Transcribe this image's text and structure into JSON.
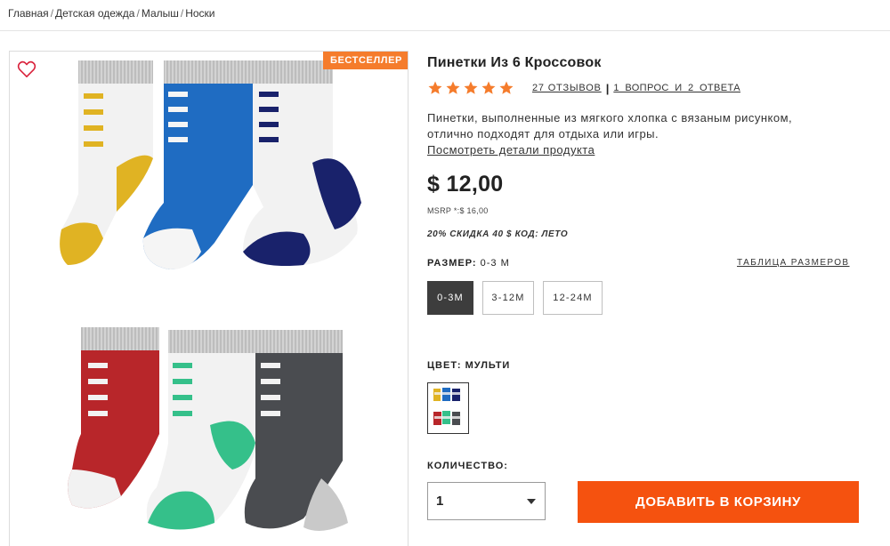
{
  "breadcrumb": {
    "items": [
      "Главная",
      "Детская одежда",
      "Малыш",
      "Носки"
    ],
    "separator": "/"
  },
  "product": {
    "badge": "БЕСТСЕЛЛЕР",
    "title": "Пинетки Из 6 Кроссовок",
    "rating": 5,
    "rating_max": 5,
    "reviews_label": "27 ОТЗЫВОВ",
    "qa_label": "1 ВОПРОС  И  2 ОТВЕТА",
    "description_line1": "Пинетки, выполненные из мягкого хлопка с вязаным рисунком,",
    "description_line2": "отлично подходят для отдыха или игры.",
    "details_link": "Посмотреть детали продукта",
    "price": "$ 12,00",
    "msrp": "MSRP *:$ 16,00",
    "promo": "20% СКИДКА 40 $ КОД: ЛЕТО"
  },
  "size": {
    "label": "РАЗМЕР:",
    "selected_value": "0-3 М",
    "chart_link": "ТАБЛИЦА РАЗМЕРОВ",
    "options": [
      "0-3М",
      "3-12М",
      "12-24М"
    ],
    "selected_index": 0
  },
  "color": {
    "label": "ЦВЕТ: МУЛЬТИ"
  },
  "quantity": {
    "label": "КОЛИЧЕСТВО:",
    "value": "1"
  },
  "cart": {
    "add_label": "ДОБАВИТЬ В КОРЗИНУ"
  },
  "colors": {
    "accent": "#f5520f",
    "badge": "#f57c2c",
    "star": "#f57c2c",
    "selected_size_bg": "#3d3d3d",
    "sock_yellow": "#e0b323",
    "sock_blue": "#1f6cc2",
    "sock_navy": "#19226b",
    "sock_red": "#b8262a",
    "sock_green": "#35c08a",
    "sock_charcoal": "#4a4c50",
    "sock_gray": "#c9c9c9"
  },
  "icons": {
    "favorite": "heart-outline-icon",
    "star": "star-icon",
    "dropdown": "caret-down-icon"
  }
}
